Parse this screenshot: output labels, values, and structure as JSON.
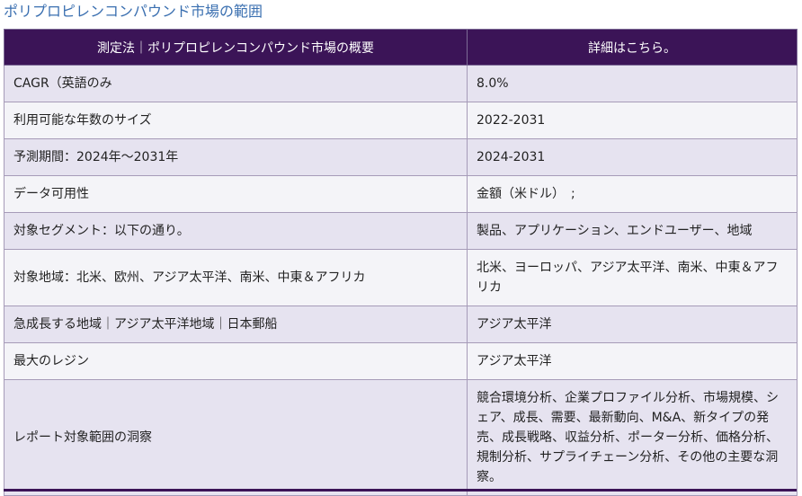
{
  "page": {
    "title": "ポリプロピレンコンパウンド市場の範囲"
  },
  "table": {
    "header": {
      "col1": "測定法｜ポリプロピレンコンパウンド市場の概要",
      "col2": "詳細はこちら。"
    },
    "rows": [
      {
        "label": "CAGR（英語のみ",
        "value": "8.0%"
      },
      {
        "label": "利用可能な年数のサイズ",
        "value": "2022-2031"
      },
      {
        "label": "予測期間：2024年～2031年",
        "value": "2024-2031"
      },
      {
        "label": "データ可用性",
        "value": "金額（米ドル）　;"
      },
      {
        "label": "対象セグメント：以下の通り。",
        "value": "製品、アプリケーション、エンドユーザー、地域"
      },
      {
        "label": "対象地域：北米、欧州、アジア太平洋、南米、中東＆アフリカ",
        "value": "北米、ヨーロッパ、アジア太平洋、南米、中東＆アフリカ"
      },
      {
        "label": "急成長する地域｜アジア太平洋地域｜日本郵船",
        "value": "アジア太平洋"
      },
      {
        "label": "最大のレジン",
        "value": "アジア太平洋"
      },
      {
        "label": "レポート対象範囲の洞察",
        "value": "競合環境分析、企業プロファイル分析、市場規模、シェア、成長、需要、最新動向、M&A、新タイプの発売、成長戦略、収益分析、ポーター分析、価格分析、規制分析、サプライチェーン分析、その他の主要な洞察。"
      }
    ]
  }
}
